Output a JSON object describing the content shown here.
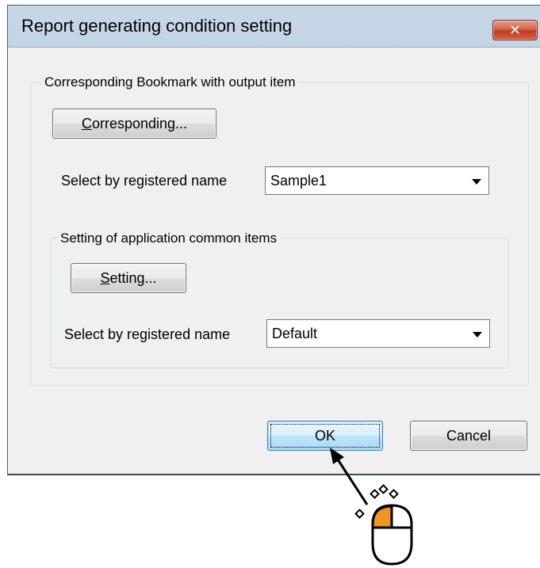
{
  "dialog": {
    "title": "Report generating condition setting",
    "close_symbol": "✕"
  },
  "group_bookmark": {
    "title": "Corresponding Bookmark with output item",
    "button_accel": "C",
    "button_rest": "orresponding...",
    "select_label": "Select by registered name",
    "select_value": "Sample1"
  },
  "group_common": {
    "title": "Setting of application common items",
    "button_accel": "S",
    "button_rest": "etting...",
    "select_label": "Select by registered name",
    "select_value": "Default"
  },
  "footer": {
    "ok_label": "OK",
    "cancel_label": "Cancel"
  },
  "annotation": {
    "icon": "mouse-left-click-icon",
    "accent": "#f0961e"
  }
}
